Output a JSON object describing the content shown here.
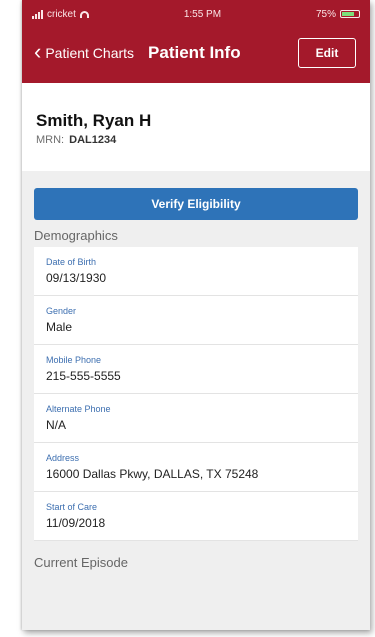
{
  "status": {
    "carrier": "cricket",
    "time": "1:55 PM",
    "battery": "75%"
  },
  "nav": {
    "back_label": "Patient Charts",
    "title": "Patient Info",
    "edit_label": "Edit"
  },
  "patient": {
    "name": "Smith, Ryan H",
    "mrn_label": "MRN:",
    "mrn_value": "DAL1234"
  },
  "verify_label": "Verify Eligibility",
  "demographics": {
    "title": "Demographics",
    "fields": [
      {
        "label": "Date of Birth",
        "value": "09/13/1930"
      },
      {
        "label": "Gender",
        "value": "Male"
      },
      {
        "label": "Mobile Phone",
        "value": "215-555-5555"
      },
      {
        "label": "Alternate Phone",
        "value": "N/A"
      },
      {
        "label": "Address",
        "value": "16000 Dallas Pkwy, DALLAS, TX 75248"
      },
      {
        "label": "Start of Care",
        "value": "11/09/2018"
      }
    ]
  },
  "next_section": "Current Episode",
  "colors": {
    "header": "#a4192b",
    "button": "#2e73b8",
    "label": "#3d6fb0"
  }
}
